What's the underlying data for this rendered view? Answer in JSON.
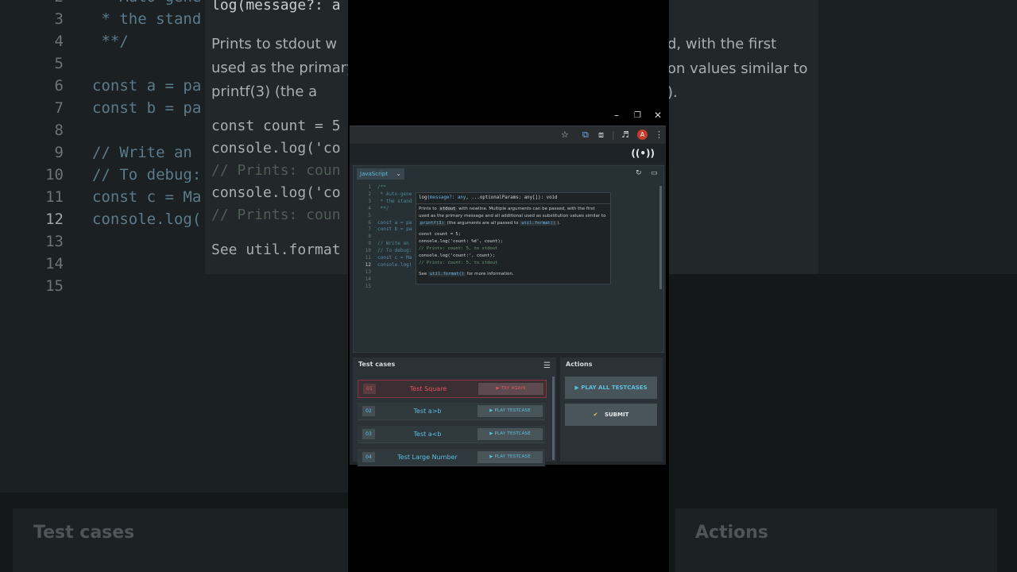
{
  "background": {
    "code_lines": [
      {
        "num": "2",
        "text": "  * Auto-gene"
      },
      {
        "num": "3",
        "text": "  * the stand"
      },
      {
        "num": "4",
        "text": "  **/"
      },
      {
        "num": "5",
        "text": ""
      },
      {
        "num": "6",
        "text": "const a = pa"
      },
      {
        "num": "7",
        "text": "const b = pa"
      },
      {
        "num": "8",
        "text": ""
      },
      {
        "num": "9",
        "text": "// Write an"
      },
      {
        "num": "10",
        "text": "// To debug:"
      },
      {
        "num": "11",
        "text": "const c = Ma"
      },
      {
        "num": "12",
        "text": "console.log("
      },
      {
        "num": "13",
        "text": ""
      },
      {
        "num": "14",
        "text": ""
      },
      {
        "num": "15",
        "text": ""
      }
    ],
    "tooltip_sig": "log(message?: a",
    "tooltip_lines": [
      "Prints to  stdout  w",
      "used as the primary",
      " printf(3)  (the a",
      "const count = 5",
      "console.log('co",
      "// Prints: coun",
      "console.log('co",
      "// Prints: coun",
      "See  util.format"
    ],
    "right_tooltip_lines": [
      "d, with the first",
      "on values similar to",
      ")."
    ],
    "panel_left_title": "Test cases",
    "panel_right_title": "Actions"
  },
  "window": {
    "minimize": "–",
    "restore": "❐",
    "close": "✕"
  },
  "browser": {
    "avatar_letter": "A"
  },
  "editor": {
    "language": "JavaScript",
    "lines": [
      {
        "num": "1",
        "text": "/**",
        "kind": "comment"
      },
      {
        "num": "2",
        "text": " * Auto-gene",
        "kind": "comment"
      },
      {
        "num": "3",
        "text": " * the stand",
        "kind": "comment"
      },
      {
        "num": "4",
        "text": " **/",
        "kind": "comment"
      },
      {
        "num": "5",
        "text": "",
        "kind": "code"
      },
      {
        "num": "6",
        "text": "const a = pa",
        "kind": "code"
      },
      {
        "num": "7",
        "text": "const b = pa",
        "kind": "code"
      },
      {
        "num": "8",
        "text": "",
        "kind": "code"
      },
      {
        "num": "9",
        "text": "// Write an",
        "kind": "comment"
      },
      {
        "num": "10",
        "text": "// To debug:",
        "kind": "comment"
      },
      {
        "num": "11",
        "text": "const c = Ma",
        "kind": "code"
      },
      {
        "num": "12",
        "text": "console.log(",
        "kind": "code"
      },
      {
        "num": "13",
        "text": "",
        "kind": "code"
      },
      {
        "num": "14",
        "text": "",
        "kind": "code"
      },
      {
        "num": "15",
        "text": "",
        "kind": "code"
      }
    ],
    "active_line": "12",
    "tooltip": {
      "sig_prefix": "log(",
      "sig_param1": "message?:",
      "sig_type1": "any",
      "sig_rest": ", ...optionalParams: any[]): void",
      "desc1_a": "Prints to ",
      "desc1_code": "stdout",
      "desc1_b": " with newline. Multiple arguments can be passed, with the first",
      "desc2": "used as the primary message and all additional used as substitution values similar to",
      "desc3_code": "printf(3)",
      "desc3_a": " (the arguments are all passed to ",
      "desc3_code2": "util.format()",
      "desc3_b": ").",
      "ex1": "const count = 5;",
      "ex2": "console.log('count: %d', count);",
      "ex3": "// Prints: count: 5, to stdout",
      "ex4": "console.log('count:', count);",
      "ex5": "// Prints: count: 5, to stdout",
      "see_a": "See ",
      "see_code": "util.format()",
      "see_b": " for more information."
    }
  },
  "test_cases": {
    "title": "Test cases",
    "items": [
      {
        "num": "01",
        "name": "Test Square",
        "button": "▶ TRY AGAIN",
        "status": "fail"
      },
      {
        "num": "02",
        "name": "Test a>b",
        "button": "▶ PLAY TESTCASE",
        "status": "idle"
      },
      {
        "num": "03",
        "name": "Test a<b",
        "button": "▶ PLAY TESTCASE",
        "status": "idle"
      },
      {
        "num": "04",
        "name": "Test Large Number",
        "button": "▶ PLAY TESTCASE",
        "status": "idle"
      }
    ]
  },
  "actions": {
    "title": "Actions",
    "play_all": "▶  PLAY ALL TESTCASES",
    "submit_icon": "✔",
    "submit": "SUBMIT"
  },
  "colors": {
    "accent": "#5bc0de",
    "fail": "#e2525f",
    "submit_check": "#f2c94c"
  }
}
